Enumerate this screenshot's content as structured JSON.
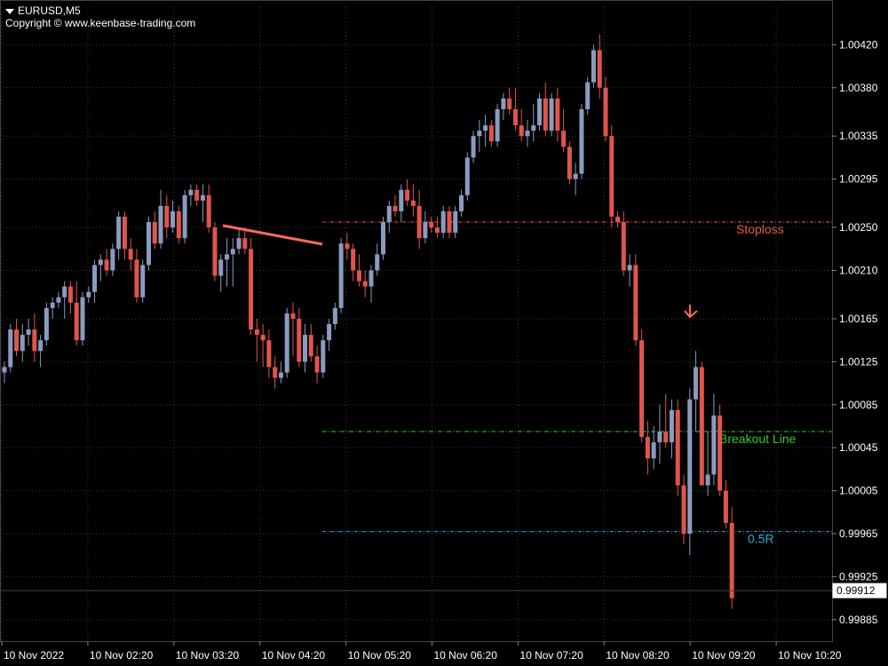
{
  "header": {
    "symbol": "EURUSD,M5",
    "copyright": "Copyright © www.keenbase-trading.com"
  },
  "colors": {
    "background": "#000000",
    "bull": "#8a9bbf",
    "bear": "#e0554b",
    "grid": "#3a3a3a",
    "text": "#ffffff",
    "stoploss": "#e8594a",
    "breakout": "#33cc33",
    "half_r": "#2ea8e0",
    "trendline": "#ff6b55",
    "arrow": "#ff6b55"
  },
  "chart_data": {
    "type": "candlestick",
    "symbol": "EURUSD",
    "timeframe": "M5",
    "price_range": [
      0.99865,
      1.00455
    ],
    "price_ticks": [
      "1.00420",
      "1.00380",
      "1.00335",
      "1.00295",
      "1.00250",
      "1.00210",
      "1.00165",
      "1.00125",
      "1.00085",
      "1.00045",
      "1.00005",
      "0.99965",
      "0.99925",
      "0.99885"
    ],
    "time_labels": [
      "10 Nov 2022",
      "10 Nov 02:20",
      "10 Nov 03:20",
      "10 Nov 04:20",
      "10 Nov 05:20",
      "10 Nov 06:20",
      "10 Nov 07:20",
      "10 Nov 08:20",
      "10 Nov 09:20",
      "10 Nov 10:20"
    ],
    "current_price": "0.99912",
    "levels": [
      {
        "name": "Stoploss",
        "label": "Stoploss",
        "price": 1.00255,
        "color": "#e8594a"
      },
      {
        "name": "Breakout Line",
        "label": "Breakout Line",
        "price": 1.0006,
        "color": "#33cc33"
      },
      {
        "name": "0.5R",
        "label": "0.5R",
        "price": 0.99967,
        "color": "#2ea8e0"
      }
    ],
    "trendline": {
      "from": [
        1.00255
      ],
      "to": [
        1.00235
      ]
    },
    "candles": [
      [
        1.00115,
        1.00125,
        1.00105,
        1.0012
      ],
      [
        1.0012,
        1.0016,
        1.00115,
        1.00155
      ],
      [
        1.00155,
        1.00165,
        1.0013,
        1.00135
      ],
      [
        1.00135,
        1.0016,
        1.00125,
        1.0015
      ],
      [
        1.0015,
        1.00165,
        1.0014,
        1.00155
      ],
      [
        1.00155,
        1.0017,
        1.00125,
        1.00135
      ],
      [
        1.00135,
        1.0015,
        1.0012,
        1.00145
      ],
      [
        1.00145,
        1.0018,
        1.0014,
        1.00175
      ],
      [
        1.00175,
        1.00185,
        1.00165,
        1.0018
      ],
      [
        1.0018,
        1.0019,
        1.00175,
        1.00185
      ],
      [
        1.00185,
        1.002,
        1.00165,
        1.00195
      ],
      [
        1.00195,
        1.002,
        1.0017,
        1.0018
      ],
      [
        1.0018,
        1.002,
        1.0014,
        1.00145
      ],
      [
        1.00145,
        1.0019,
        1.0014,
        1.00185
      ],
      [
        1.00185,
        1.00195,
        1.0018,
        1.0019
      ],
      [
        1.0019,
        1.0022,
        1.0018,
        1.00215
      ],
      [
        1.00215,
        1.00225,
        1.002,
        1.0022
      ],
      [
        1.0022,
        1.0023,
        1.00205,
        1.0021
      ],
      [
        1.0021,
        1.00235,
        1.00205,
        1.0023
      ],
      [
        1.0023,
        1.00265,
        1.0022,
        1.0026
      ],
      [
        1.0026,
        1.00265,
        1.0022,
        1.0023
      ],
      [
        1.0023,
        1.0024,
        1.0021,
        1.0022
      ],
      [
        1.0022,
        1.0023,
        1.0018,
        1.00185
      ],
      [
        1.00185,
        1.0022,
        1.0018,
        1.00215
      ],
      [
        1.00215,
        1.0026,
        1.0021,
        1.00255
      ],
      [
        1.00255,
        1.00265,
        1.0023,
        1.00235
      ],
      [
        1.00235,
        1.00285,
        1.0023,
        1.0027
      ],
      [
        1.0027,
        1.0028,
        1.0024,
        1.0025
      ],
      [
        1.0025,
        1.00275,
        1.00245,
        1.00265
      ],
      [
        1.00265,
        1.0027,
        1.00235,
        1.0024
      ],
      [
        1.0024,
        1.00285,
        1.00235,
        1.0028
      ],
      [
        1.0028,
        1.0029,
        1.0027,
        1.00285
      ],
      [
        1.00285,
        1.0029,
        1.0027,
        1.00275
      ],
      [
        1.00275,
        1.0029,
        1.00255,
        1.0028
      ],
      [
        1.0028,
        1.0029,
        1.00245,
        1.0025
      ],
      [
        1.0025,
        1.00255,
        1.002,
        1.00205
      ],
      [
        1.00205,
        1.00225,
        1.0019,
        1.0022
      ],
      [
        1.0022,
        1.0024,
        1.00195,
        1.00225
      ],
      [
        1.00225,
        1.0024,
        1.00195,
        1.0023
      ],
      [
        1.0023,
        1.0025,
        1.00225,
        1.0024
      ],
      [
        1.0024,
        1.0025,
        1.00225,
        1.0023
      ],
      [
        1.0023,
        1.0024,
        1.0015,
        1.00155
      ],
      [
        1.00155,
        1.00165,
        1.00125,
        1.0015
      ],
      [
        1.0015,
        1.0016,
        1.0012,
        1.00145
      ],
      [
        1.00145,
        1.00155,
        1.0011,
        1.0012
      ],
      [
        1.0012,
        1.0013,
        1.001,
        1.0011
      ],
      [
        1.0011,
        1.00125,
        1.00105,
        1.00115
      ],
      [
        1.00115,
        1.00175,
        1.0011,
        1.0017
      ],
      [
        1.0017,
        1.0018,
        1.0013,
        1.00165
      ],
      [
        1.00165,
        1.00175,
        1.0012,
        1.00125
      ],
      [
        1.00125,
        1.0016,
        1.00115,
        1.0015
      ],
      [
        1.0015,
        1.0016,
        1.00125,
        1.0013
      ],
      [
        1.0013,
        1.0014,
        1.00105,
        1.00115
      ],
      [
        1.00115,
        1.0015,
        1.0011,
        1.00145
      ],
      [
        1.00145,
        1.00165,
        1.00135,
        1.0016
      ],
      [
        1.0016,
        1.0018,
        1.00155,
        1.00175
      ],
      [
        1.00175,
        1.0024,
        1.0017,
        1.00235
      ],
      [
        1.00235,
        1.00245,
        1.0022,
        1.0023
      ],
      [
        1.0023,
        1.00235,
        1.002,
        1.0021
      ],
      [
        1.0021,
        1.00225,
        1.00195,
        1.002
      ],
      [
        1.002,
        1.0021,
        1.00185,
        1.00195
      ],
      [
        1.00195,
        1.00215,
        1.0018,
        1.0021
      ],
      [
        1.0021,
        1.00235,
        1.00205,
        1.00225
      ],
      [
        1.00225,
        1.0026,
        1.0022,
        1.00255
      ],
      [
        1.00255,
        1.00275,
        1.00245,
        1.0027
      ],
      [
        1.0027,
        1.0028,
        1.0026,
        1.00265
      ],
      [
        1.00265,
        1.0029,
        1.00255,
        1.00285
      ],
      [
        1.00285,
        1.00295,
        1.0027,
        1.00275
      ],
      [
        1.00275,
        1.0029,
        1.0026,
        1.0027
      ],
      [
        1.0027,
        1.00285,
        1.0023,
        1.0024
      ],
      [
        1.0024,
        1.00265,
        1.00235,
        1.00255
      ],
      [
        1.00255,
        1.0026,
        1.00245,
        1.0025
      ],
      [
        1.0025,
        1.0026,
        1.0024,
        1.00245
      ],
      [
        1.00245,
        1.0027,
        1.0024,
        1.00265
      ],
      [
        1.00265,
        1.0027,
        1.0024,
        1.00245
      ],
      [
        1.00245,
        1.0027,
        1.0024,
        1.00265
      ],
      [
        1.00265,
        1.00285,
        1.0026,
        1.0028
      ],
      [
        1.0028,
        1.0032,
        1.00275,
        1.00315
      ],
      [
        1.00315,
        1.0034,
        1.0031,
        1.00335
      ],
      [
        1.00335,
        1.0035,
        1.0032,
        1.0034
      ],
      [
        1.0034,
        1.00355,
        1.00325,
        1.00345
      ],
      [
        1.00345,
        1.0035,
        1.00325,
        1.0033
      ],
      [
        1.0033,
        1.00365,
        1.00325,
        1.0036
      ],
      [
        1.0036,
        1.00375,
        1.0035,
        1.0037
      ],
      [
        1.0037,
        1.0038,
        1.00355,
        1.0036
      ],
      [
        1.0036,
        1.0038,
        1.0034,
        1.00345
      ],
      [
        1.00345,
        1.0036,
        1.0033,
        1.00335
      ],
      [
        1.00335,
        1.0035,
        1.00325,
        1.0034
      ],
      [
        1.0034,
        1.00365,
        1.0033,
        1.00345
      ],
      [
        1.00345,
        1.00375,
        1.0034,
        1.0037
      ],
      [
        1.0037,
        1.00385,
        1.00335,
        1.0034
      ],
      [
        1.0034,
        1.00375,
        1.00335,
        1.0037
      ],
      [
        1.0037,
        1.0038,
        1.0033,
        1.0034
      ],
      [
        1.0034,
        1.0036,
        1.0032,
        1.00325
      ],
      [
        1.00325,
        1.0033,
        1.0029,
        1.00295
      ],
      [
        1.00295,
        1.0031,
        1.0028,
        1.003
      ],
      [
        1.003,
        1.00365,
        1.00295,
        1.0036
      ],
      [
        1.0036,
        1.0039,
        1.00355,
        1.00385
      ],
      [
        1.00385,
        1.0042,
        1.0038,
        1.00415
      ],
      [
        1.00415,
        1.0043,
        1.0037,
        1.0038
      ],
      [
        1.0038,
        1.0039,
        1.0033,
        1.00335
      ],
      [
        1.00335,
        1.00345,
        1.0025,
        1.0026
      ],
      [
        1.0026,
        1.00265,
        1.0025,
        1.00255
      ],
      [
        1.00255,
        1.00265,
        1.00205,
        1.0021
      ],
      [
        1.0021,
        1.00225,
        1.00195,
        1.00215
      ],
      [
        1.00215,
        1.00225,
        1.0014,
        1.00145
      ],
      [
        1.00145,
        1.00155,
        1.0005,
        1.00055
      ],
      [
        1.00055,
        1.0007,
        1.0002,
        1.00035
      ],
      [
        1.00035,
        1.00065,
        1.00025,
        1.0005
      ],
      [
        1.0005,
        1.00085,
        1.0003,
        1.0006
      ],
      [
        1.0006,
        1.00095,
        1.00045,
        1.0005
      ],
      [
        1.0005,
        1.0009,
        1.00035,
        1.0008
      ],
      [
        1.0008,
        1.0009,
        1.0,
        1.0001
      ],
      [
        1.0001,
        1.0002,
        0.99955,
        0.99965
      ],
      [
        0.99965,
        1.001,
        0.99945,
        1.0009
      ],
      [
        1.0009,
        1.00135,
        1.0006,
        1.0012
      ],
      [
        1.0012,
        1.00125,
        1.0003,
        1.0001
      ],
      [
        1.0001,
        1.0006,
        1.0,
        1.0002
      ],
      [
        1.0002,
        1.00095,
        1.0001,
        1.00075
      ],
      [
        1.00075,
        1.00085,
        1.0,
        1.00005
      ],
      [
        1.00005,
        1.00015,
        0.9997,
        0.99975
      ],
      [
        0.99975,
        0.9999,
        0.99895,
        0.99905
      ]
    ]
  }
}
